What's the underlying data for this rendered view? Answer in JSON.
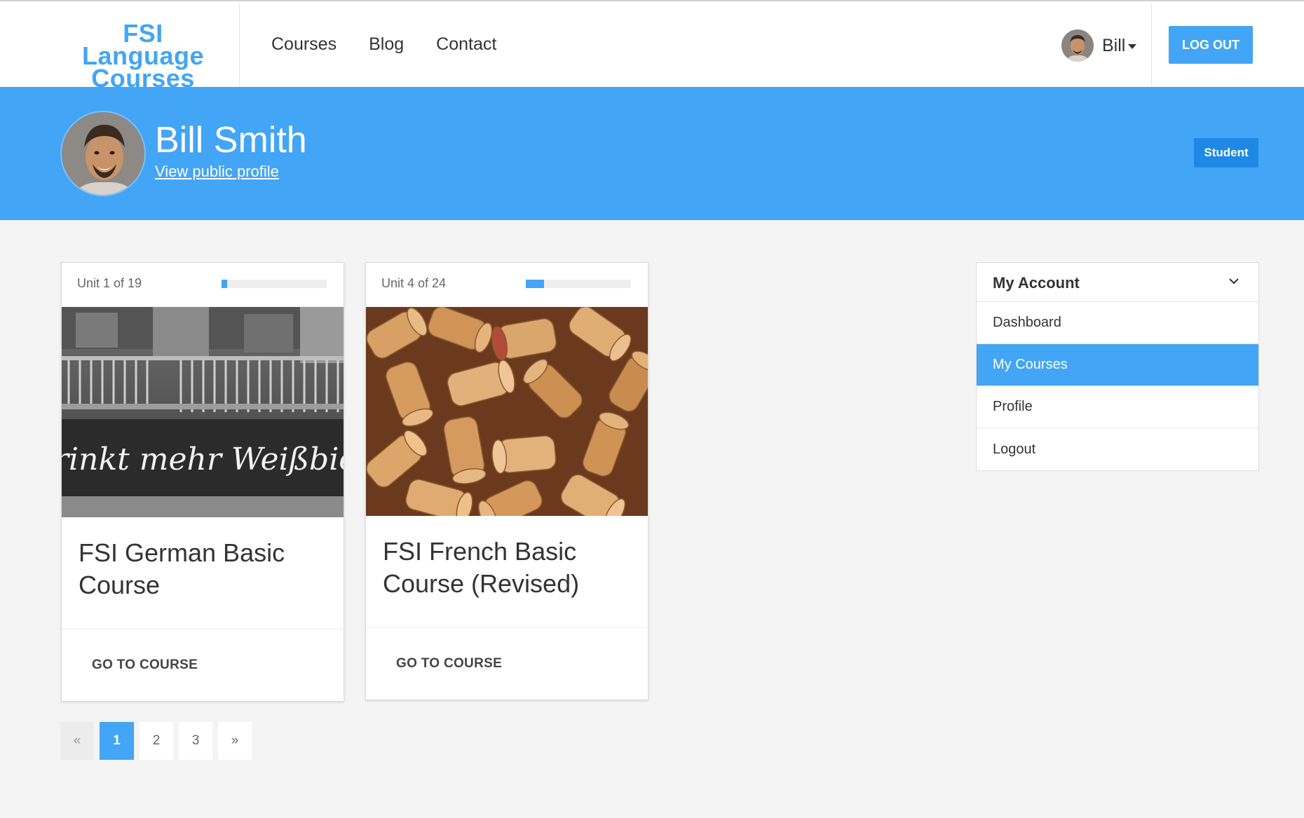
{
  "header": {
    "logo_line1": "FSI Language",
    "logo_line2": "Courses",
    "nav": [
      "Courses",
      "Blog",
      "Contact"
    ],
    "user_name": "Bill",
    "logout_label": "LOG OUT"
  },
  "profile": {
    "full_name": "Bill Smith",
    "public_profile_link": "View public profile",
    "role_badge": "Student"
  },
  "courses": [
    {
      "unit_label": "Unit 1 of 19",
      "progress_fraction": 0.05,
      "title": "FSI German Basic Course",
      "image_caption": "Trinkt mehr Weißbier",
      "action_label": "GO TO COURSE"
    },
    {
      "unit_label": "Unit 4 of 24",
      "progress_fraction": 0.17,
      "title": "FSI French Basic Course (Revised)",
      "action_label": "GO TO COURSE"
    }
  ],
  "pagination": {
    "prev": "«",
    "pages": [
      "1",
      "2",
      "3"
    ],
    "current": "1",
    "next": "»"
  },
  "sidebar": {
    "title": "My Account",
    "items": [
      {
        "label": "Dashboard",
        "active": false
      },
      {
        "label": "My Courses",
        "active": true
      },
      {
        "label": "Profile",
        "active": false
      },
      {
        "label": "Logout",
        "active": false
      }
    ]
  },
  "colors": {
    "accent": "#42a5f5",
    "badge": "#1e88e5",
    "background": "#f4f4f4"
  }
}
